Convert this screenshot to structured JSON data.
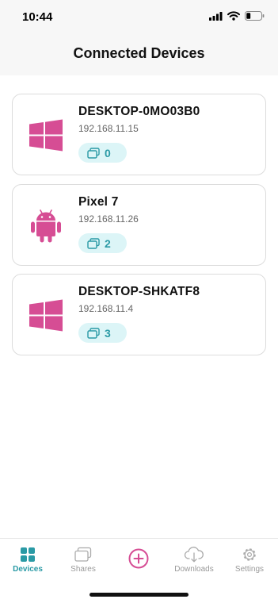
{
  "status_bar": {
    "time": "10:44"
  },
  "header": {
    "title": "Connected Devices"
  },
  "devices": [
    {
      "name": "DESKTOP-0MO03B0",
      "ip": "192.168.11.15",
      "shares": "0",
      "os_icon": "windows-icon"
    },
    {
      "name": "Pixel 7",
      "ip": "192.168.11.26",
      "shares": "2",
      "os_icon": "android-icon"
    },
    {
      "name": "DESKTOP-SHKATF8",
      "ip": "192.168.11.4",
      "shares": "3",
      "os_icon": "windows-icon"
    }
  ],
  "tab_bar": {
    "tabs": [
      {
        "label": "Devices",
        "icon": "grid-icon",
        "active": true
      },
      {
        "label": "Shares",
        "icon": "shares-icon"
      },
      {
        "label": "",
        "icon": "add-circle-icon"
      },
      {
        "label": "Downloads",
        "icon": "cloud-download-icon"
      },
      {
        "label": "Settings",
        "icon": "gear-icon"
      }
    ]
  },
  "colors": {
    "accent": "#2a9aa5",
    "os_icon": "#d64d94",
    "pill_bg": "#dcf5f7"
  }
}
